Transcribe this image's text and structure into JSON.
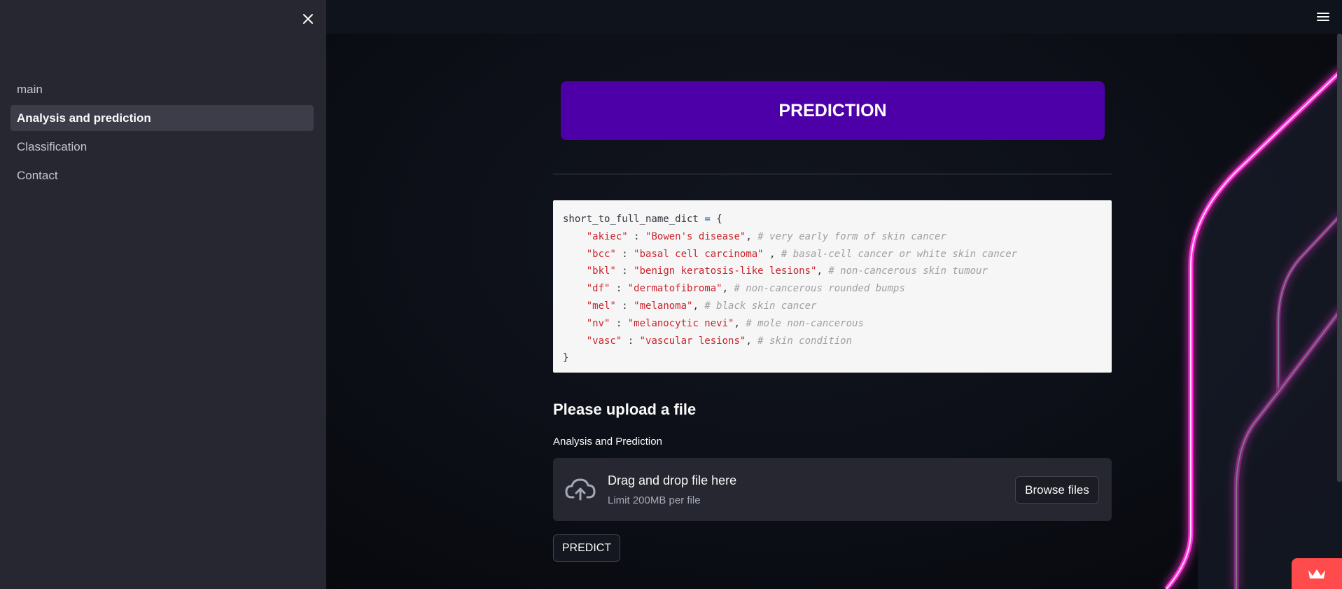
{
  "sidebar": {
    "close_icon": "close-icon",
    "items": [
      {
        "label": "main",
        "active": false
      },
      {
        "label": "Analysis and prediction",
        "active": true
      },
      {
        "label": "Classification",
        "active": false
      },
      {
        "label": "Contact",
        "active": false
      }
    ]
  },
  "header": {
    "menu_icon": "hamburger-menu-icon"
  },
  "banner": {
    "title": "PREDICTION",
    "color": "#4d00a8"
  },
  "code": {
    "line0": {
      "var": "short_to_full_name_dict",
      "eq": "=",
      "brace": "{"
    },
    "lines": [
      {
        "key": "\"akiec\"",
        "value": "\"Bowen's disease\"",
        "comment": "# very early form of skin cancer"
      },
      {
        "key": "\"bcc\"",
        "value": "\"basal cell carcinoma\"",
        "comment": "# basal-cell cancer or white skin cancer"
      },
      {
        "key": "\"bkl\"",
        "value": "\"benign keratosis-like lesions\"",
        "comment": "# non-cancerous skin tumour"
      },
      {
        "key": "\"df\"",
        "value": "\"dermatofibroma\"",
        "comment": "# non-cancerous rounded bumps"
      },
      {
        "key": "\"mel\"",
        "value": "\"melanoma\"",
        "comment": "# black skin cancer"
      },
      {
        "key": "\"nv\"",
        "value": "\"melanocytic nevi\"",
        "comment": "# mole non-cancerous"
      },
      {
        "key": "\"vasc\"",
        "value": "\"vascular lesions\"",
        "comment": "# skin condition"
      }
    ],
    "closing": "}"
  },
  "upload": {
    "heading": "Please upload a file",
    "label": "Analysis and Prediction",
    "drag_text": "Drag and drop file here",
    "limit_text": "Limit 200MB per file",
    "browse_label": "Browse files",
    "icon": "cloud-upload-icon"
  },
  "predict_button": "PREDICT",
  "accent_color": "#ff4b4b"
}
